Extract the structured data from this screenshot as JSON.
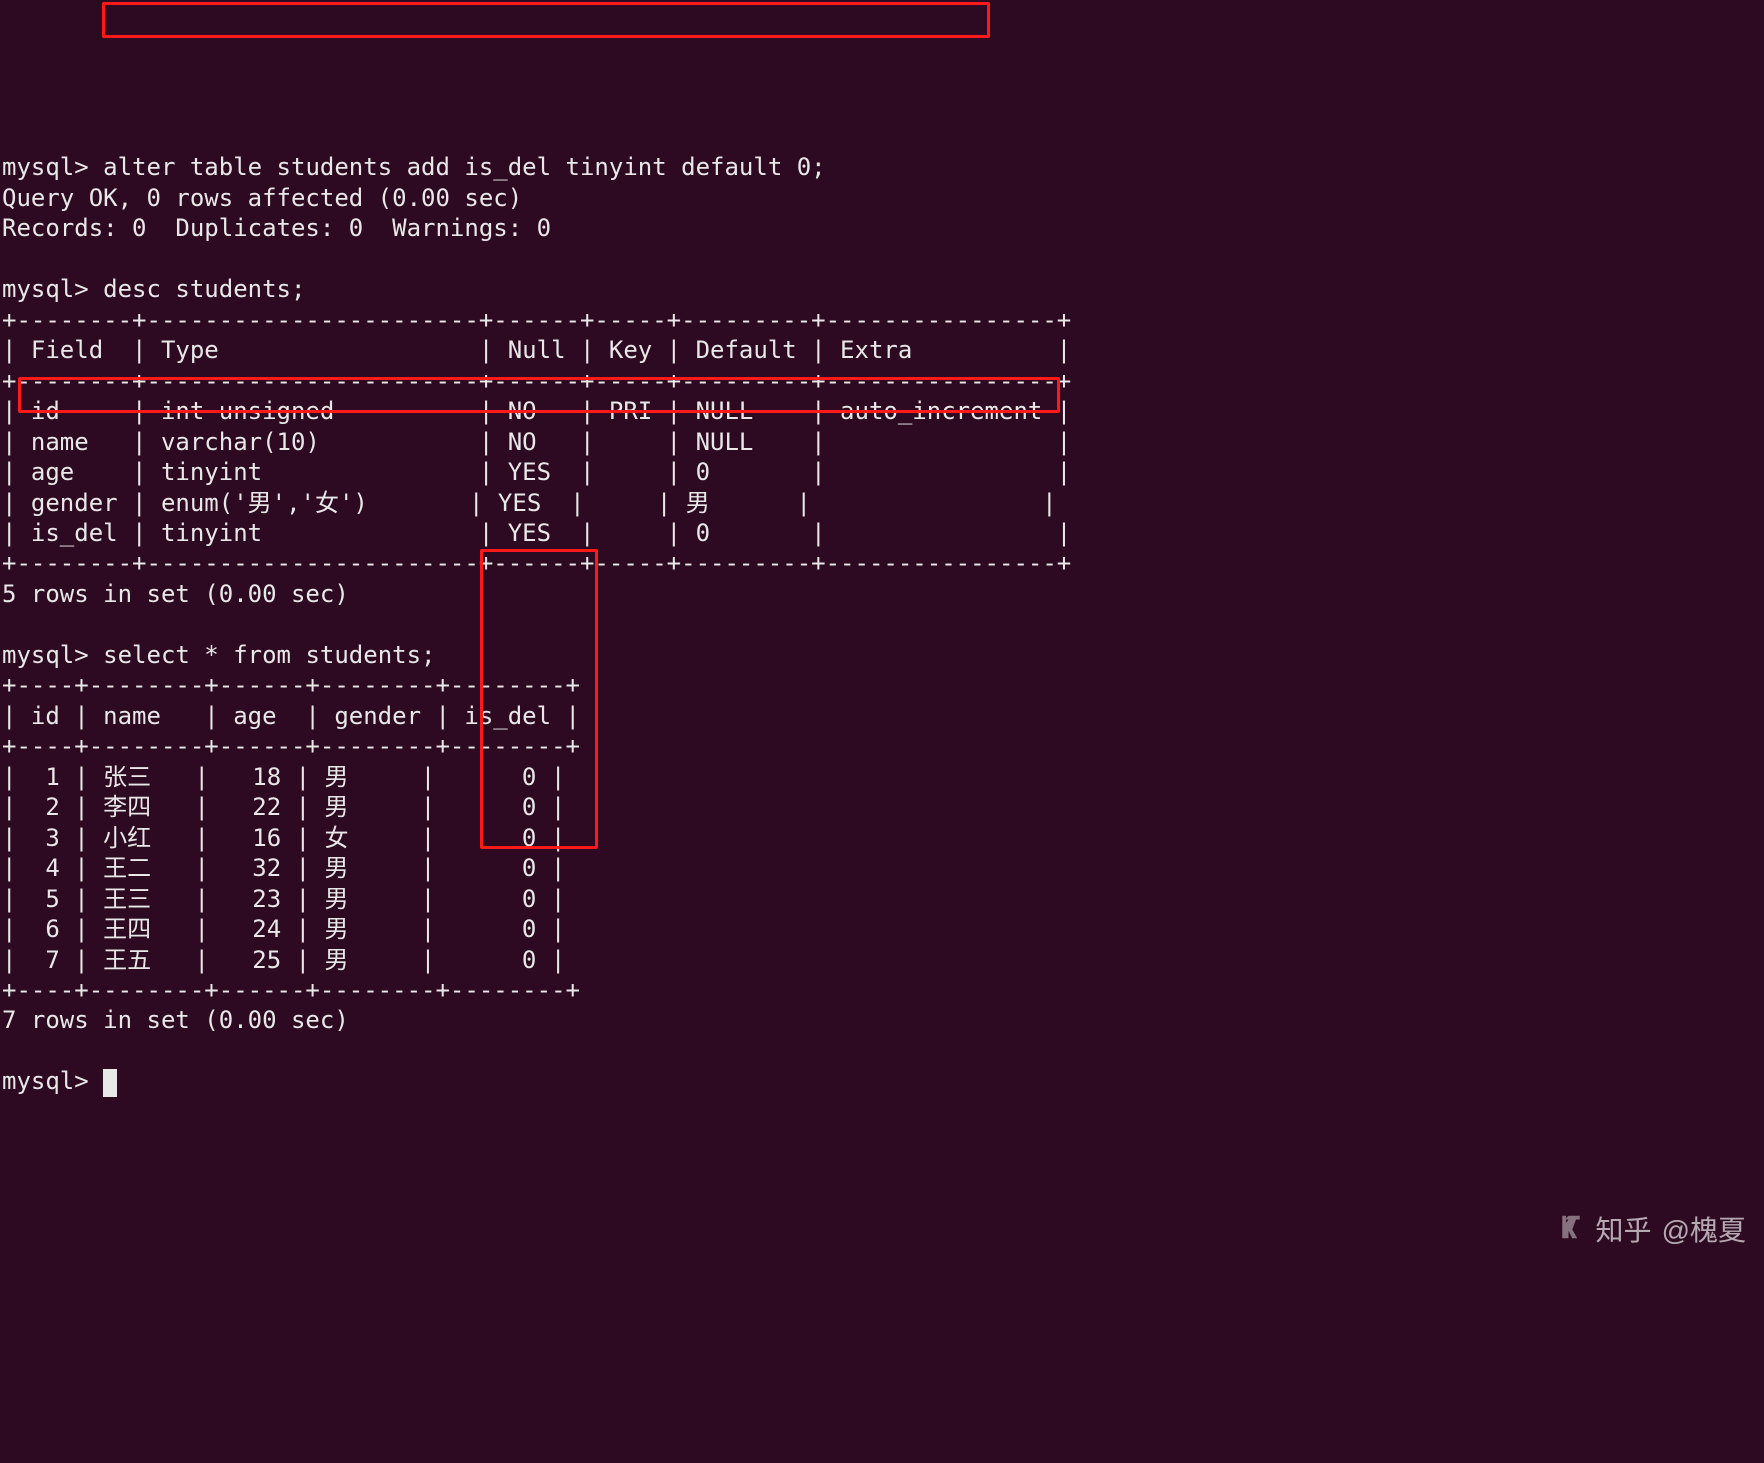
{
  "prompt": "mysql> ",
  "lines": {
    "cmd_alter": "alter table students add is_del tinyint default 0;",
    "res_ok": "Query OK, 0 rows affected (0.00 sec)",
    "res_records": "Records: 0  Duplicates: 0  Warnings: 0",
    "cmd_desc": "desc students;",
    "desc_sep": "+--------+-----------------------+------+-----+---------+----------------+",
    "desc_header": "| Field  | Type                  | Null | Key | Default | Extra          |",
    "desc_rows": [
      "| id     | int unsigned          | NO   | PRI | NULL    | auto_increment |",
      "| name   | varchar(10)           | NO   |     | NULL    |                |",
      "| age    | tinyint               | YES  |     | 0       |                |",
      "| gender | enum('男','女')       | YES  |     | 男      |                |",
      "| is_del | tinyint               | YES  |     | 0       |                |"
    ],
    "desc_footer": "5 rows in set (0.00 sec)",
    "cmd_select": "select * from students;",
    "sel_sep": "+----+--------+------+--------+--------+",
    "sel_header": "| id | name   | age  | gender | is_del |",
    "sel_rows": [
      "|  1 | 张三   |   18 | 男     |      0 |",
      "|  2 | 李四   |   22 | 男     |      0 |",
      "|  3 | 小红   |   16 | 女     |      0 |",
      "|  4 | 王二   |   32 | 男     |      0 |",
      "|  5 | 王三   |   23 | 男     |      0 |",
      "|  6 | 王四   |   24 | 男     |      0 |",
      "|  7 | 王五   |   25 | 男     |      0 |"
    ],
    "sel_footer": "7 rows in set (0.00 sec)"
  },
  "watermark": {
    "brand": "知乎",
    "author": "@槐夏"
  },
  "chart_data": {
    "type": "table",
    "desc_table": {
      "columns": [
        "Field",
        "Type",
        "Null",
        "Key",
        "Default",
        "Extra"
      ],
      "rows": [
        [
          "id",
          "int unsigned",
          "NO",
          "PRI",
          "NULL",
          "auto_increment"
        ],
        [
          "name",
          "varchar(10)",
          "NO",
          "",
          "NULL",
          ""
        ],
        [
          "age",
          "tinyint",
          "YES",
          "",
          "0",
          ""
        ],
        [
          "gender",
          "enum('男','女')",
          "YES",
          "",
          "男",
          ""
        ],
        [
          "is_del",
          "tinyint",
          "YES",
          "",
          "0",
          ""
        ]
      ]
    },
    "select_table": {
      "columns": [
        "id",
        "name",
        "age",
        "gender",
        "is_del"
      ],
      "rows": [
        [
          1,
          "张三",
          18,
          "男",
          0
        ],
        [
          2,
          "李四",
          22,
          "男",
          0
        ],
        [
          3,
          "小红",
          16,
          "女",
          0
        ],
        [
          4,
          "王二",
          32,
          "男",
          0
        ],
        [
          5,
          "王三",
          23,
          "男",
          0
        ],
        [
          6,
          "王四",
          24,
          "男",
          0
        ],
        [
          7,
          "王五",
          25,
          "男",
          0
        ]
      ]
    }
  }
}
